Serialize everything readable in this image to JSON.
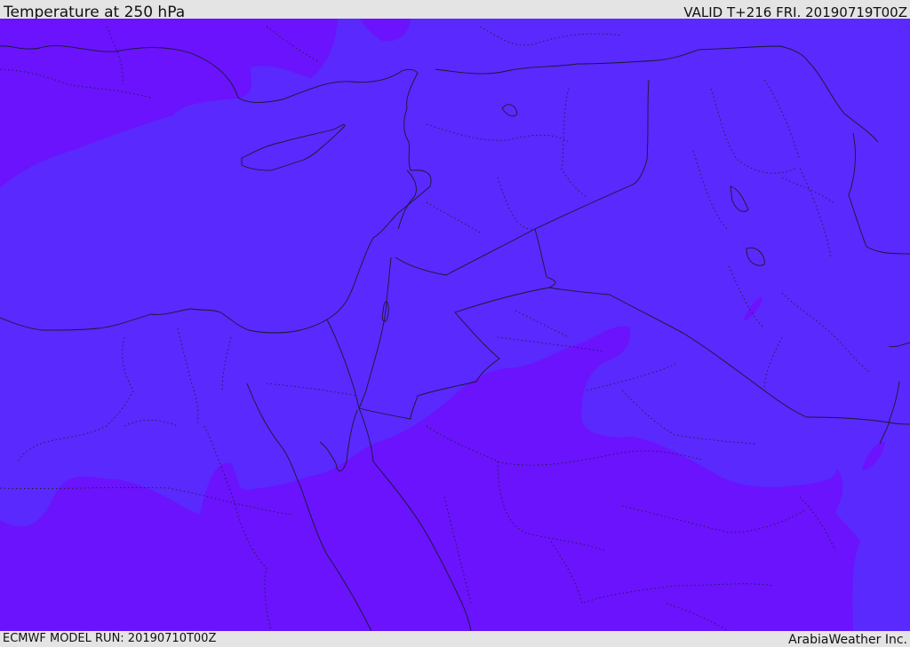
{
  "header": {
    "title": "Temperature at 250 hPa",
    "valid": "VALID T+216 FRI. 20190719T00Z"
  },
  "footer": {
    "model_run": "ECMWF MODEL RUN: 20190710T00Z",
    "credit": "ArabiaWeather Inc."
  },
  "map": {
    "colors": {
      "warmer_band": "#5a29fd",
      "cooler_band": "#6a13fc",
      "coastline": "#1a1a2a",
      "border": "#1a1a2a"
    }
  }
}
